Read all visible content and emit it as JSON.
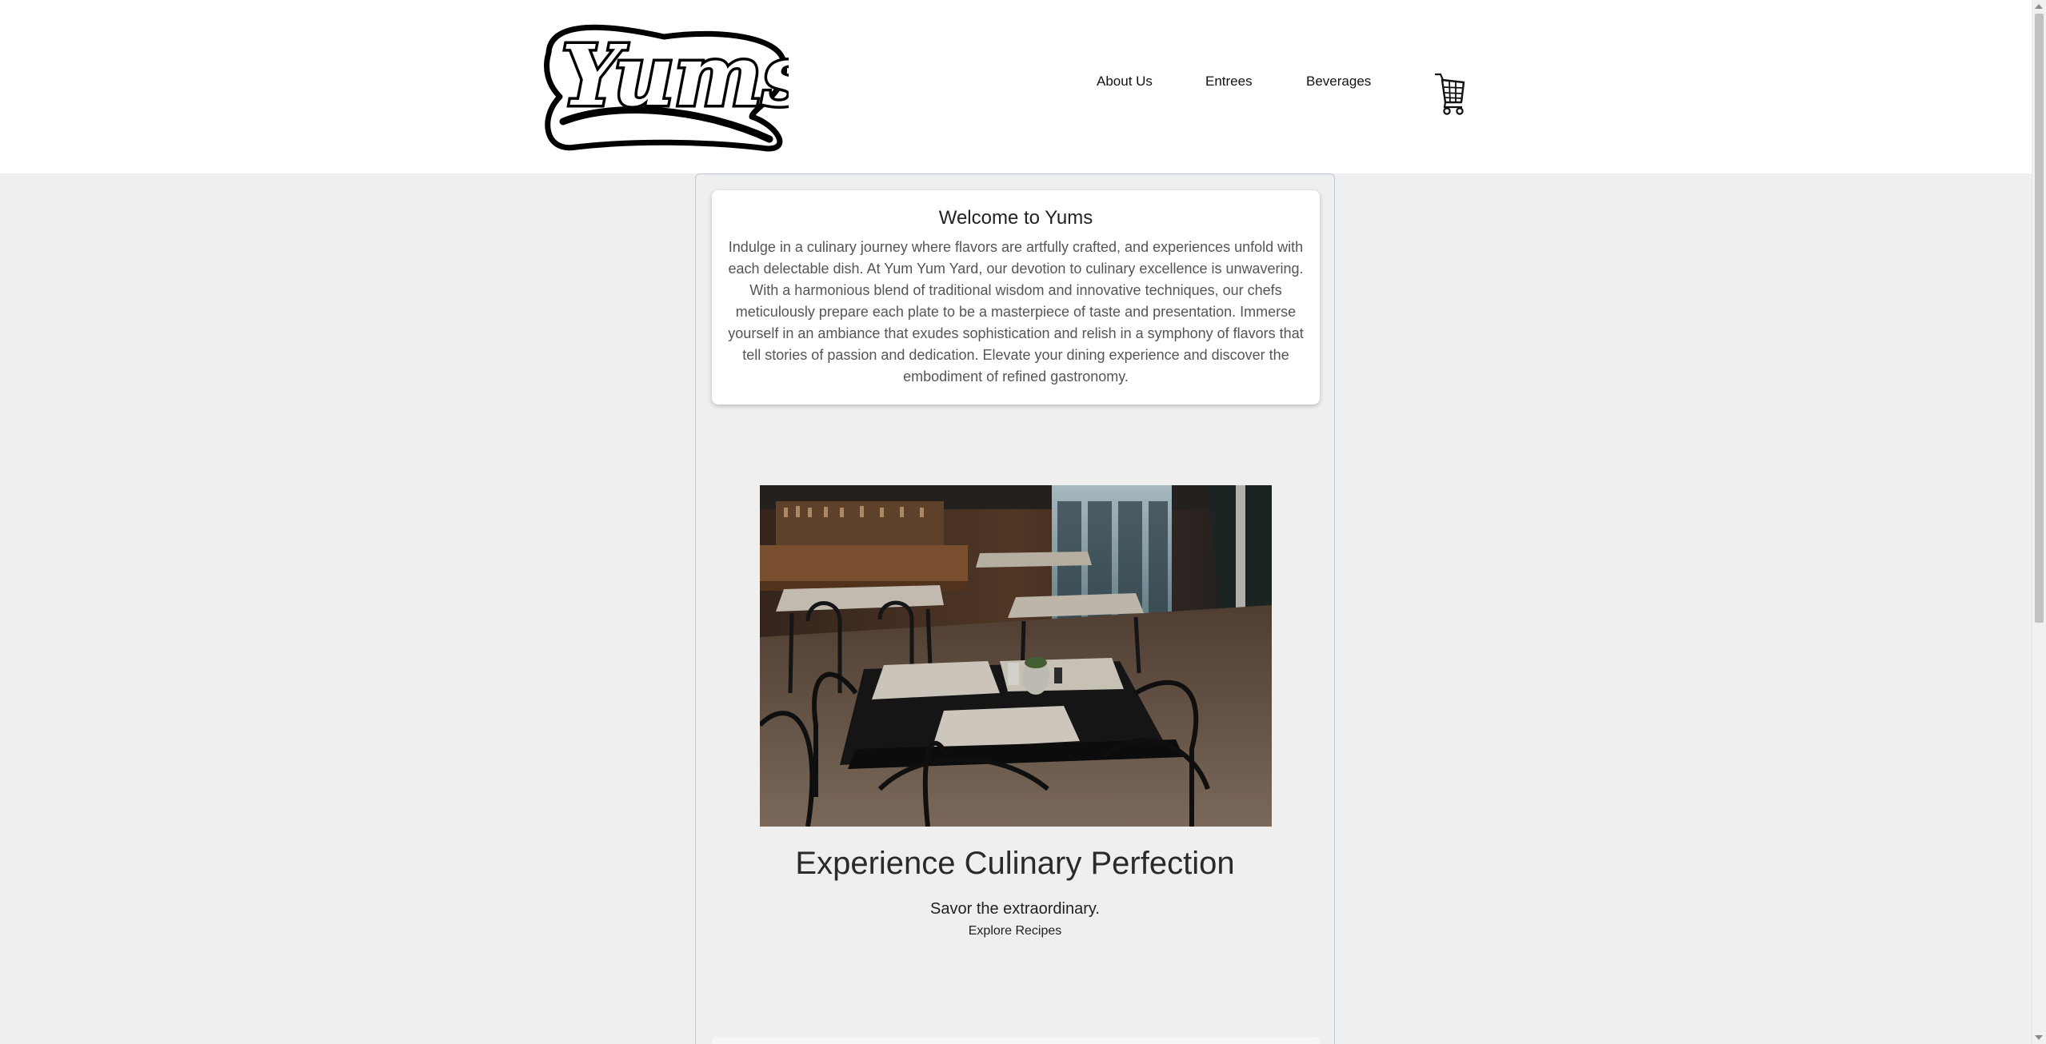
{
  "header": {
    "logo_text": "Yums",
    "nav": {
      "about": "About Us",
      "entrees": "Entrees",
      "beverages": "Beverages"
    },
    "cart_icon": "shopping-cart-icon"
  },
  "welcome": {
    "title": "Welcome to Yums",
    "body": "Indulge in a culinary journey where flavors are artfully crafted, and experiences unfold with each delectable dish. At Yum Yum Yard, our devotion to culinary excellence is unwavering. With a harmonious blend of traditional wisdom and innovative techniques, our chefs meticulously prepare each plate to be a masterpiece of taste and presentation. Immerse yourself in an ambiance that exudes sophistication and relish in a symphony of flavors that tell stories of passion and dedication. Elevate your dining experience and discover the embodiment of refined gastronomy."
  },
  "hero": {
    "image": "restaurant-interior-photo",
    "title": "Experience Culinary Perfection",
    "subtitle": "Savor the extraordinary.",
    "link": "Explore Recipes"
  },
  "colors": {
    "page_bg": "#efefef",
    "header_bg": "#ffffff",
    "frame_border": "#b9c6e0",
    "body_text": "#555555"
  }
}
